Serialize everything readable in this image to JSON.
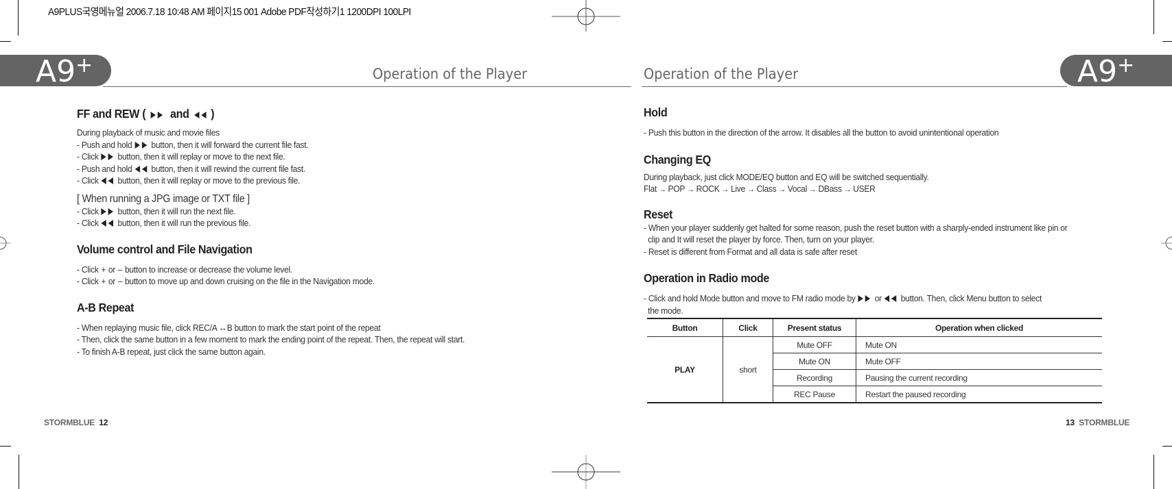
{
  "print_slug": "A9PLUS국영메뉴얼  2006.7.18 10:48 AM 페이지15   001 Adobe PDF작성하기1 1200DPI 100LPI",
  "brand_logo": {
    "text": "A9",
    "plus": "+"
  },
  "left_page": {
    "title": "Operation of the Player",
    "sections": [
      {
        "heading_pre": "FF and REW (",
        "heading_mid": "and",
        "heading_post": ")",
        "intro": "During playback of music and movie files",
        "lines": [
          {
            "pre": "- Push and hold",
            "icon": "fast-forward",
            "post": "button, then it will forward the current file fast."
          },
          {
            "pre": "- Click",
            "icon": "fast-forward",
            "post": "button, then it will replay or move to the next file."
          },
          {
            "pre": "- Push and hold",
            "icon": "rewind",
            "post": "button, then it will rewind the current file fast."
          },
          {
            "pre": "- Click",
            "icon": "rewind",
            "post": "button, then it will replay or move to the previous file."
          }
        ],
        "subheading": "[ When running a JPG image or TXT file ]",
        "sub_lines": [
          {
            "pre": "- Click",
            "icon": "fast-forward",
            "post": "button, then it will run the next file."
          },
          {
            "pre": "- Click",
            "icon": "rewind",
            "post": "button, then it will run the previous file."
          }
        ]
      },
      {
        "heading": "Volume control and File Navigation",
        "lines": [
          {
            "pre": "- Click",
            "plus": "+",
            "mid": "or",
            "minus": "–",
            "post": "button to increase or decrease the volume level."
          },
          {
            "pre": "- Click",
            "plus": "+",
            "mid": "or",
            "minus": "–",
            "post": "button to move up and down cruising on the file in the Navigation mode."
          }
        ]
      },
      {
        "heading": "A-B Repeat",
        "lines": [
          "- When replaying music file, click REC/A ↔B button to mark the start point of the repeat",
          "- Then, click the same button in a few moment to mark the ending point of the repeat. Then, the repeat will start.",
          "- To finish A-B repeat, just click the same button again."
        ]
      }
    ],
    "footer": {
      "brand": "STORMBLUE",
      "page": "12"
    }
  },
  "right_page": {
    "title": "Operation of the Player",
    "hold": {
      "heading": "Hold",
      "lines": [
        "- Push this button in the direction of the arrow. It disables all the button to avoid unintentional operation"
      ]
    },
    "eq": {
      "heading": "Changing EQ",
      "intro": "During playback, just click MODE/EQ button and EQ will be switched sequentially.",
      "sequence": [
        "Flat",
        "POP",
        "ROCK",
        "Live",
        "Class",
        "Vocal",
        "DBass",
        "USER"
      ],
      "arrow": "→"
    },
    "reset": {
      "heading": "Reset",
      "lines": [
        "- When your player suddenly get halted for some reason, push the reset button with a sharply-ended instrument like pin or",
        "  clip and It will reset the player by force. Then, turn on your player.",
        "- Reset is different from Format and all data is safe after reset"
      ]
    },
    "radio": {
      "heading": "Operation in Radio mode",
      "line1_pre": "- Click and hold Mode button and move to FM radio mode by",
      "line1_mid": "or",
      "line1_post": "button. Then, click Menu button to select",
      "line2": "  the mode."
    },
    "table": {
      "headers": [
        "Button",
        "Click",
        "Present status",
        "Operation when clicked"
      ],
      "button": "PLAY",
      "click": "short",
      "rows": [
        {
          "status": "Mute OFF",
          "operation": "Mute ON"
        },
        {
          "status": "Mute ON",
          "operation": "Mute OFF"
        },
        {
          "status": "Recording",
          "operation": "Pausing the current recording"
        },
        {
          "status": "REC Pause",
          "operation": "Restart the paused recording"
        }
      ]
    },
    "footer": {
      "brand": "STORMBLUE",
      "page": "13"
    }
  }
}
